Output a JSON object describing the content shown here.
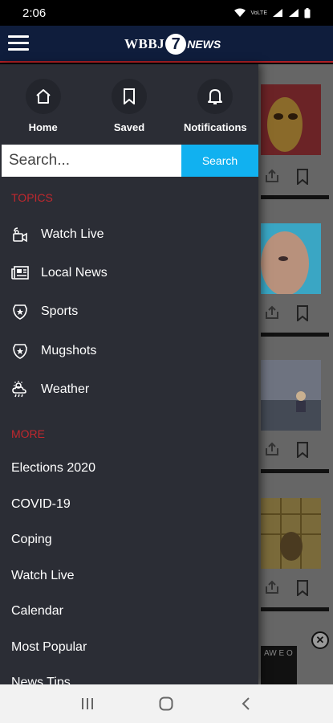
{
  "status_bar": {
    "time": "2:06",
    "network_label": "VoLTE"
  },
  "header": {
    "logo_text": "WBBJ",
    "logo_number": "7",
    "logo_news": "NEWS",
    "menu_icon": "hamburger-menu-icon"
  },
  "drawer": {
    "quick_links": [
      {
        "label": "Home",
        "icon": "home-icon"
      },
      {
        "label": "Saved",
        "icon": "bookmark-icon"
      },
      {
        "label": "Notifications",
        "icon": "bell-icon"
      }
    ],
    "search": {
      "placeholder": "Search...",
      "button_label": "Search"
    },
    "topics_heading": "TOPICS",
    "topics": [
      {
        "label": "Watch Live",
        "icon": "live-camera-icon"
      },
      {
        "label": "Local News",
        "icon": "newspaper-icon"
      },
      {
        "label": "Sports",
        "icon": "badge-icon"
      },
      {
        "label": "Mugshots",
        "icon": "badge-icon"
      },
      {
        "label": "Weather",
        "icon": "weather-icon"
      }
    ],
    "more_heading": "MORE",
    "more_items": [
      "Elections 2020",
      "COVID-19",
      "Coping",
      "Watch Live",
      "Calendar",
      "Most Popular",
      "News Tips"
    ]
  },
  "background": {
    "ad_text": "AW E O"
  },
  "colors": {
    "header_bg": "#0f1d3c",
    "accent_red": "#c0282e",
    "search_blue": "#11b1f0",
    "drawer_bg": "#2b2d35"
  }
}
